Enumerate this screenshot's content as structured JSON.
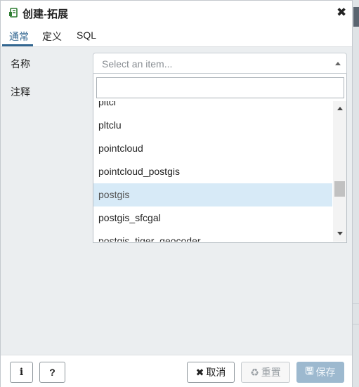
{
  "dialog": {
    "title": "创建-拓展",
    "close_symbol": "✖"
  },
  "tabs": [
    {
      "label": "通常",
      "active": true
    },
    {
      "label": "定义",
      "active": false
    },
    {
      "label": "SQL",
      "active": false
    }
  ],
  "form": {
    "name_label": "名称",
    "comment_label": "注释",
    "name_select": {
      "placeholder": "Select an item...",
      "search_value": ""
    }
  },
  "dropdown": {
    "items": [
      "pltcl",
      "pltclu",
      "pointcloud",
      "pointcloud_postgis",
      "postgis",
      "postgis_sfcgal",
      "postgis_tiger_geocoder"
    ],
    "highlighted": "postgis"
  },
  "footer": {
    "info_label": "i",
    "help_label": "?",
    "cancel_icon": "✖",
    "cancel_label": "取消",
    "reset_icon": "♻",
    "reset_label": "重置",
    "save_icon": "🖫",
    "save_label": "保存"
  },
  "colors": {
    "accent": "#326690",
    "highlight": "#d7eaf7",
    "save_disabled": "#9db9cf"
  }
}
